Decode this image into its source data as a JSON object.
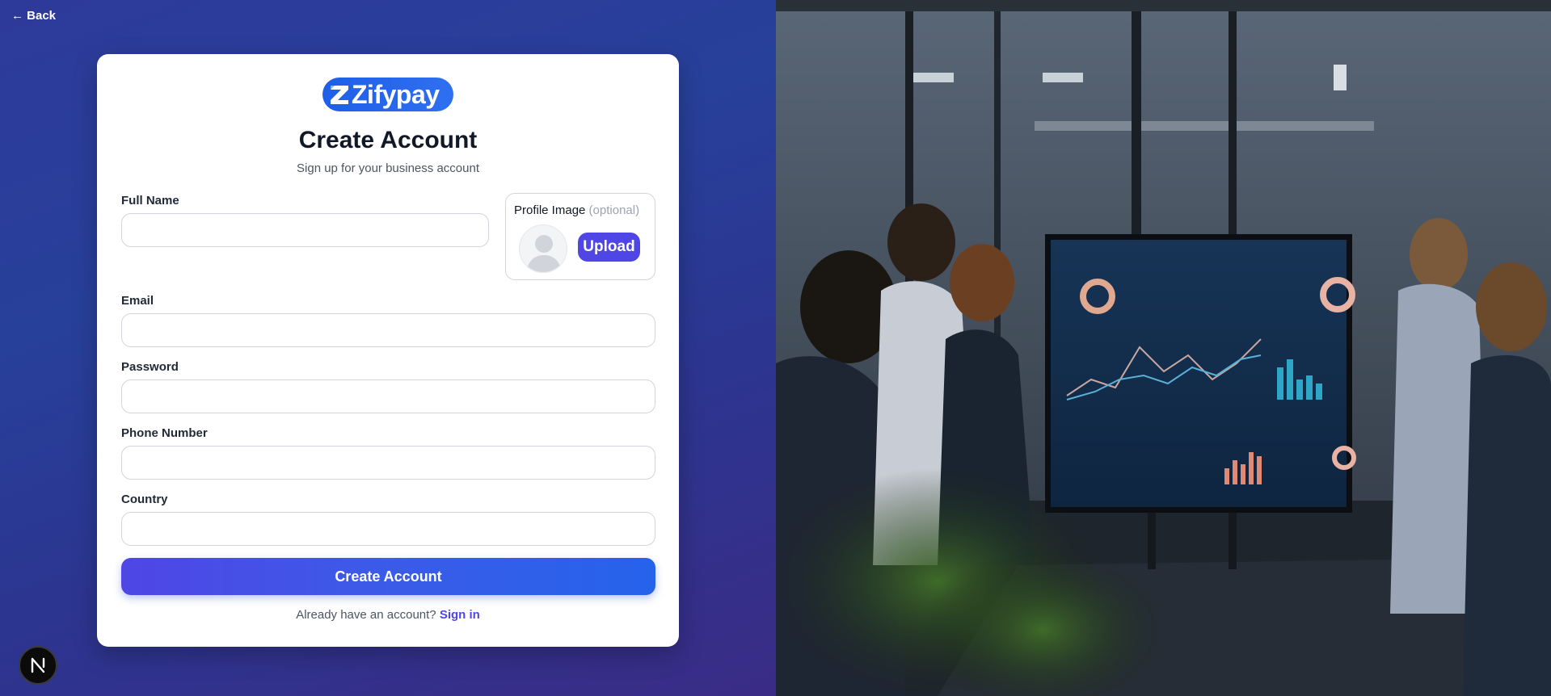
{
  "nav": {
    "back_label": "← Back"
  },
  "brand": {
    "logo_text": "Zifypay",
    "accent": "#1f5fe8"
  },
  "header": {
    "title": "Create Account",
    "subtitle": "Sign up for your business account"
  },
  "form": {
    "full_name": {
      "label": "Full Name",
      "value": "",
      "placeholder": ""
    },
    "profile_image": {
      "label": "Profile Image",
      "optional": "(optional)",
      "upload_label": "Upload"
    },
    "email": {
      "label": "Email",
      "value": "",
      "placeholder": ""
    },
    "password": {
      "label": "Password",
      "value": "",
      "placeholder": ""
    },
    "phone": {
      "label": "Phone Number",
      "value": "",
      "placeholder": ""
    },
    "country": {
      "label": "Country",
      "value": "",
      "placeholder": ""
    },
    "submit_label": "Create Account"
  },
  "footer": {
    "signin_prompt": "Already have an account?",
    "signin_link": "Sign in"
  },
  "badge": {
    "letter": "N"
  },
  "colors": {
    "primary": "#4f46e5",
    "primary_end": "#2563eb",
    "background_start": "#2e3a9a",
    "background_end": "#3a2c86"
  }
}
